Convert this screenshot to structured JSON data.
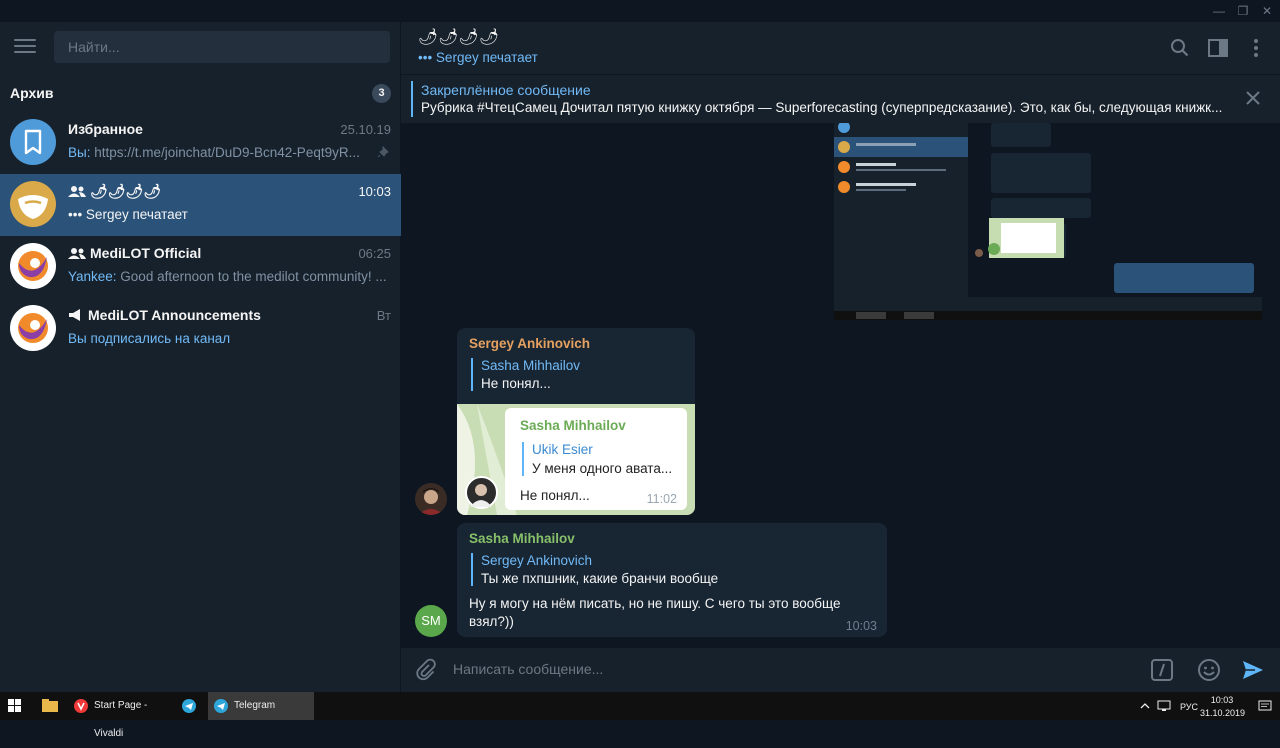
{
  "window": {
    "minimize": "—",
    "maximize": "❐",
    "close": "✕"
  },
  "sidebar": {
    "search_placeholder": "Найти...",
    "archive_label": "Архив",
    "archive_count": "3",
    "chats": [
      {
        "name": "Избранное",
        "time": "25.10.19",
        "sender": "Вы:",
        "preview": " https://t.me/joinchat/DuD9-Bcn42-Peqt9yR...",
        "pinned": true
      },
      {
        "name": "🌶🌶🌶🌶",
        "time": "10:03",
        "sender": "",
        "preview": "••• Sergey печатает",
        "group": true
      },
      {
        "name": "MediLOT Official",
        "time": "06:25",
        "sender": "Yankee:",
        "preview": " Good afternoon to the medilot community! ...",
        "group": true
      },
      {
        "name": "MediLOT Announcements",
        "time": "Вт",
        "sender": "",
        "preview": "Вы подписались на канал",
        "channel": true
      }
    ]
  },
  "header": {
    "title": "🌶🌶🌶🌶",
    "status": "••• Sergey печатает"
  },
  "pinned": {
    "title": "Закреплённое сообщение",
    "text": "Рубрика #ЧтецСамец  Дочитал пятую книжку октября — Superforecasting (суперпредсказание). Это, как бы, следующая книжк..."
  },
  "messages": [
    {
      "author": "Sergey Ankinovich",
      "reply_name": "Sasha Mihhailov",
      "reply_text": "Не понял...",
      "image": {
        "author": "Sasha Mihhailov",
        "reply_name": "Ukik Esier",
        "reply_text": "У меня одного авата...",
        "text": "Не понял...",
        "time": "11:02"
      }
    },
    {
      "author": "Sasha Mihhailov",
      "avatar_initials": "SM",
      "reply_name": "Sergey Ankinovich",
      "reply_text": "Ты же пхпшник, какие бранчи вообще",
      "text": "Ну я могу на нём писать, но не пишу. С чего ты это вообще взял?))",
      "time": "10:03"
    }
  ],
  "composer": {
    "placeholder": "Написать сообщение..."
  },
  "taskbar": {
    "apps": [
      {
        "label": "Start Page - Vivaldi"
      },
      {
        "label": "Telegram"
      }
    ],
    "lang": "РУС",
    "time": "10:03",
    "date": "31.10.2019"
  },
  "colors": {
    "accent": "#5eb5f7",
    "sidebar_bg": "#17212b",
    "chat_bg": "#0e1621",
    "active": "#2b5278",
    "sergey_name": "#e5a160",
    "sasha_name": "#87c069"
  }
}
